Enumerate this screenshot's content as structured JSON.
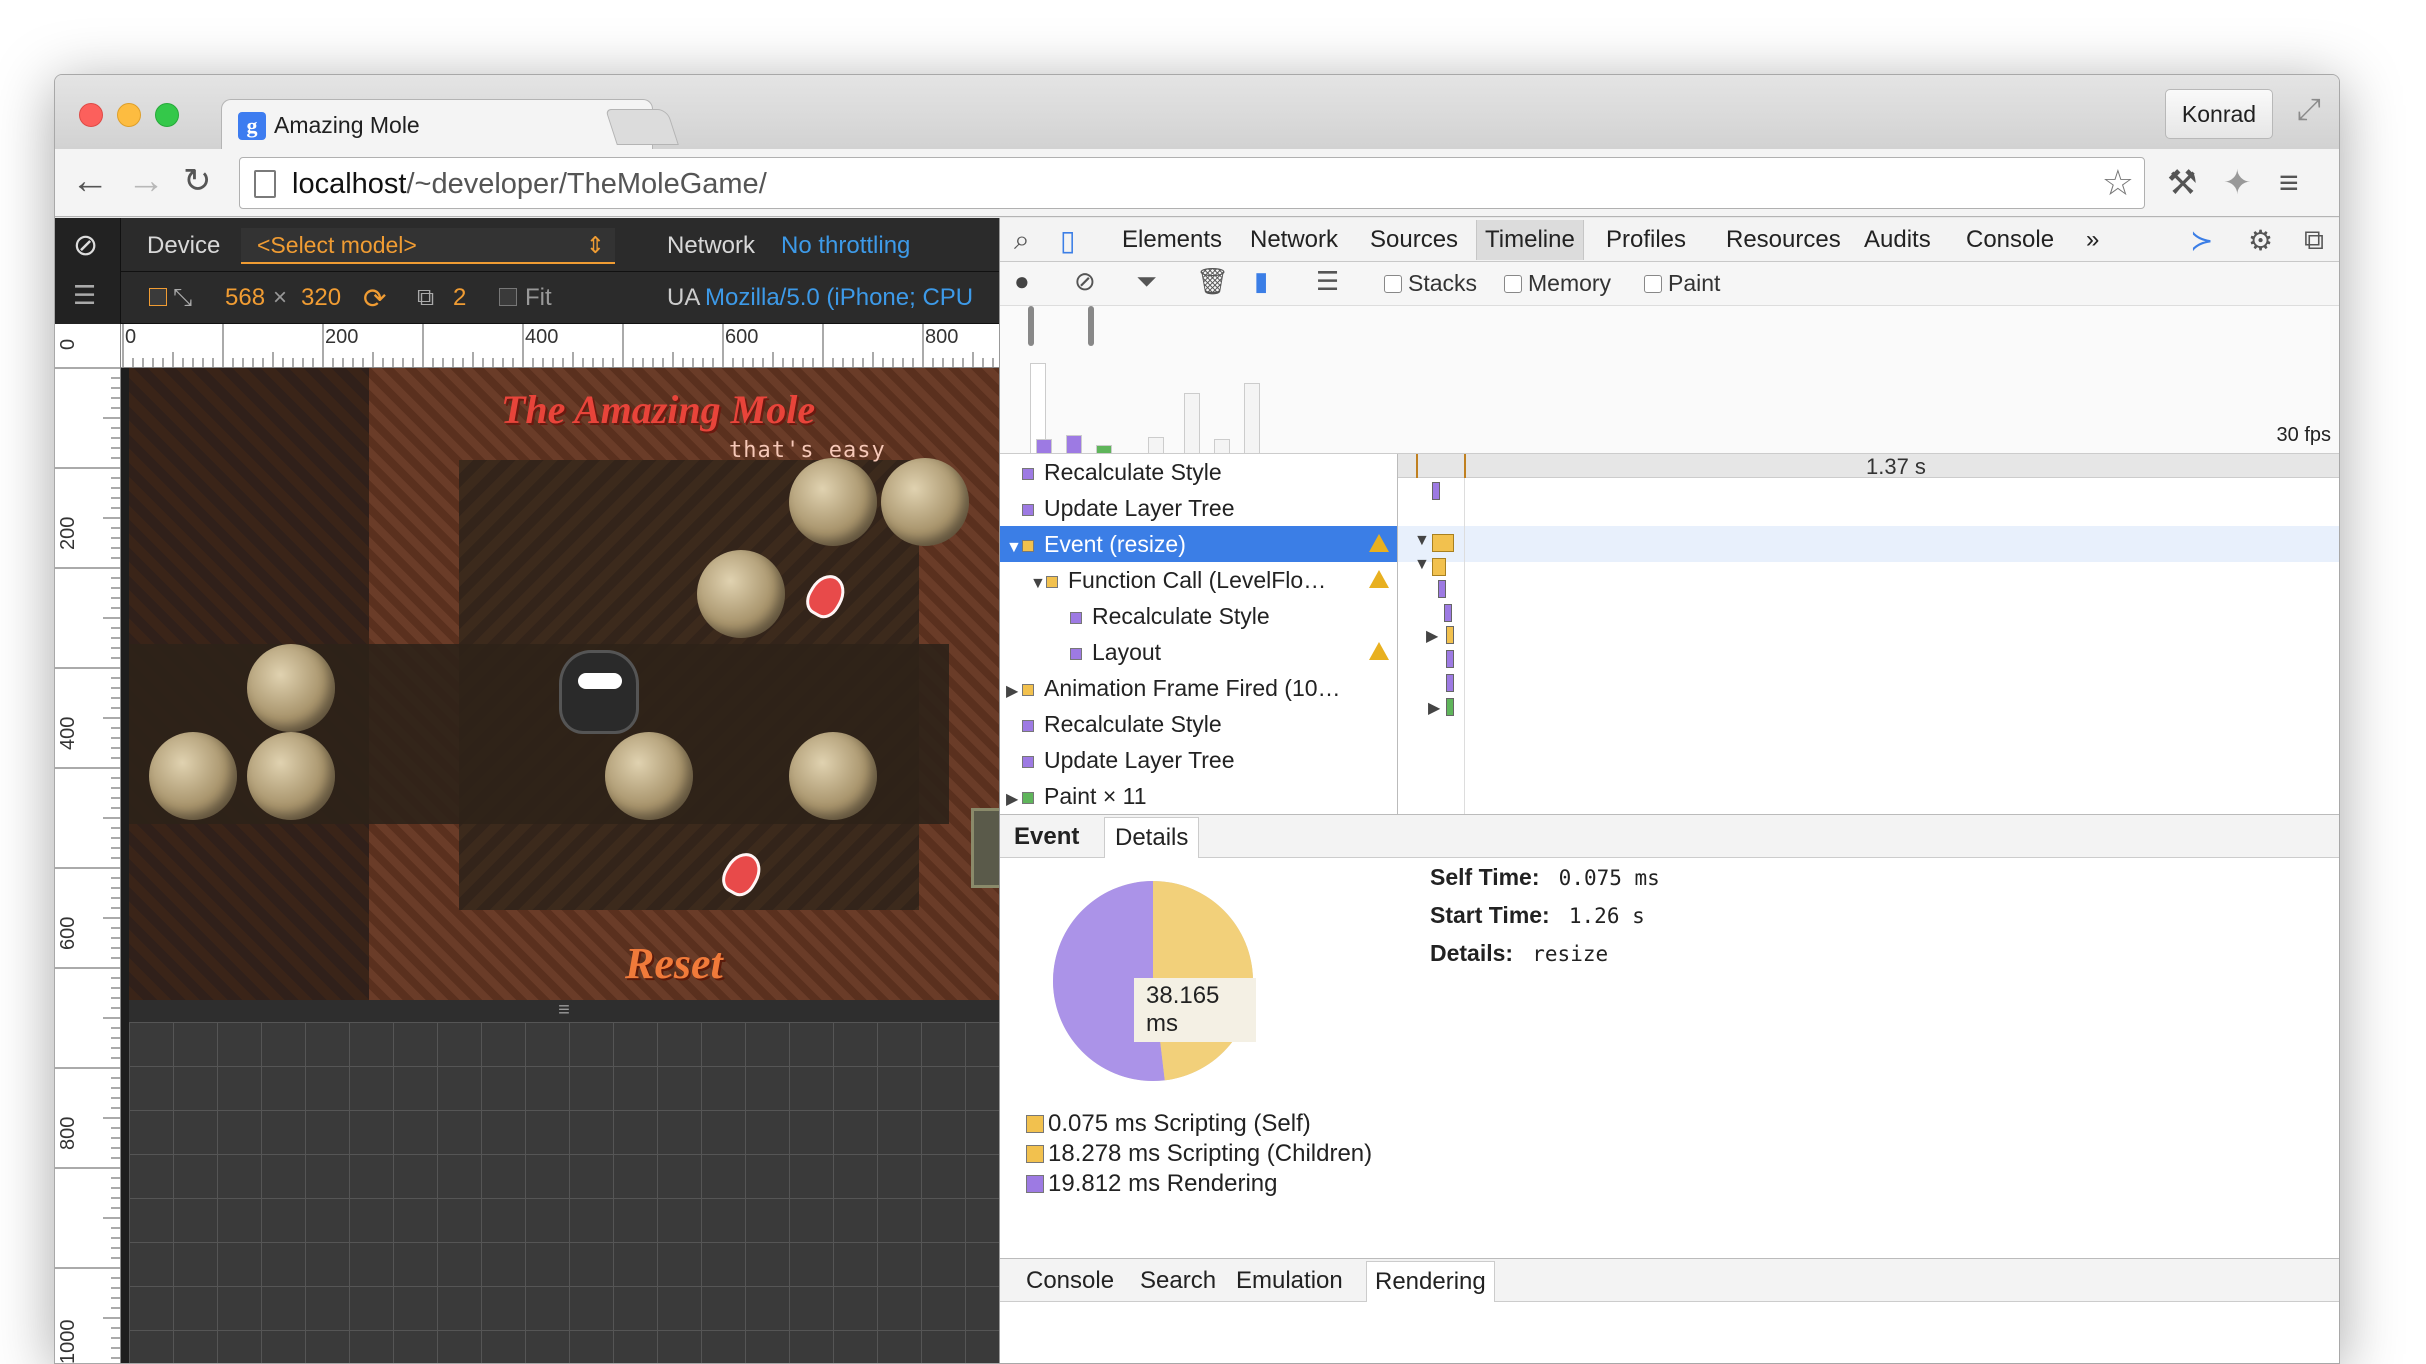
{
  "browser": {
    "tab_title": "Amazing Mole",
    "tab_favicon_letter": "g",
    "tab_close": "×",
    "profile_name": "Konrad",
    "url_host": "localhost",
    "url_path": "/~developer/TheMoleGame/"
  },
  "icons": {
    "back": "←",
    "forward": "→",
    "reload": "↻",
    "star": "☆",
    "paint_bucket": "⚒",
    "extension": "✦",
    "menu": "≡",
    "fullscreen": "⤢",
    "no": "⊘",
    "list": "☰"
  },
  "emulation": {
    "device_label": "Device",
    "model_placeholder": "<Select model>",
    "network_label": "Network",
    "throttling": "No throttling",
    "width": "568",
    "times": "×",
    "height": "320",
    "scale": "2",
    "fit_label": "Fit",
    "ua_label": "UA",
    "ua_value": "Mozilla/5.0 (iPhone; CPU",
    "ruler_h": [
      "0",
      "200",
      "400",
      "600",
      "800"
    ],
    "ruler_v": [
      "0",
      "200",
      "400",
      "600",
      "800",
      "1000"
    ]
  },
  "game": {
    "title": "The Amazing Mole",
    "subtitle": "that's easy",
    "reset": "Reset"
  },
  "devtools": {
    "panels": [
      "Elements",
      "Network",
      "Sources",
      "Timeline",
      "Profiles",
      "Resources",
      "Audits",
      "Console"
    ],
    "active_panel": "Timeline",
    "more": "»",
    "close": "×",
    "checkboxes": [
      "Stacks",
      "Memory",
      "Paint"
    ],
    "fps_label": "30 fps",
    "time_label": "1.37 s",
    "records": [
      {
        "label": "Recalculate Style",
        "color": "#9d7ae3",
        "indent": 0,
        "arrow": "",
        "warn": false,
        "selected": false
      },
      {
        "label": "Update Layer Tree",
        "color": "#9d7ae3",
        "indent": 0,
        "arrow": "",
        "warn": false,
        "selected": false
      },
      {
        "label": "Event (resize)",
        "color": "#f2c14e",
        "indent": 0,
        "arrow": "▼",
        "warn": true,
        "selected": true
      },
      {
        "label": "Function Call (LevelFlo…",
        "color": "#f2c14e",
        "indent": 1,
        "arrow": "▼",
        "warn": true,
        "selected": false
      },
      {
        "label": "Recalculate Style",
        "color": "#9d7ae3",
        "indent": 2,
        "arrow": "",
        "warn": false,
        "selected": false
      },
      {
        "label": "Layout",
        "color": "#9d7ae3",
        "indent": 2,
        "arrow": "",
        "warn": true,
        "selected": false
      },
      {
        "label": "Animation Frame Fired (10…",
        "color": "#f2c14e",
        "indent": 0,
        "arrow": "▶",
        "warn": false,
        "selected": false
      },
      {
        "label": "Recalculate Style",
        "color": "#9d7ae3",
        "indent": 0,
        "arrow": "",
        "warn": false,
        "selected": false
      },
      {
        "label": "Update Layer Tree",
        "color": "#9d7ae3",
        "indent": 0,
        "arrow": "",
        "warn": false,
        "selected": false
      },
      {
        "label": "Paint × 11",
        "color": "#5fb55b",
        "indent": 0,
        "arrow": "▶",
        "warn": false,
        "selected": false
      }
    ],
    "detail_tabs": [
      "Event",
      "Details"
    ],
    "pie_total": "38.165 ms",
    "pie": {
      "scripting_fraction": 0.4812,
      "rendering_fraction": 0.5188,
      "scripting_color": "#f2d07a",
      "rendering_color": "#ab93e8"
    },
    "legend": [
      {
        "text": "0.075 ms Scripting (Self)",
        "color": "#f2c14e"
      },
      {
        "text": "18.278 ms Scripting (Children)",
        "color": "#f2c14e"
      },
      {
        "text": "19.812 ms Rendering",
        "color": "#9d7ae3"
      }
    ],
    "summary": {
      "self_time_label": "Self Time:",
      "self_time": "0.075 ms",
      "start_time_label": "Start Time:",
      "start_time": "1.26 s",
      "details_label": "Details:",
      "details": "resize"
    },
    "drawer_tabs": [
      "Console",
      "Search",
      "Emulation",
      "Rendering"
    ],
    "active_drawer_tab": "Rendering"
  }
}
